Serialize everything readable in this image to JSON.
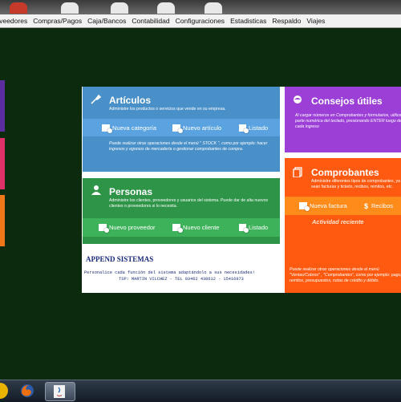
{
  "menu": {
    "items": [
      "Proveedores",
      "Compras/Pagos",
      "Caja/Bancos",
      "Contabilidad",
      "Configuraciones",
      "Estadisticas",
      "Respaldo",
      "Viajes"
    ]
  },
  "articulos": {
    "title": "Artículos",
    "description": "Administre los productos o servicios que vende en su empresa.",
    "actions": [
      "Nueva categoría",
      "Nuevo artículo",
      "Listado"
    ],
    "note": "Puede realizar otras operaciones desde el menú \" STOCK \", como por ejemplo: hacer ingresos y egresos de mercadería o gestionar comprobantes de compra.",
    "color": "#4a90c8",
    "bar_color": "#5ba3e0"
  },
  "personas": {
    "title": "Personas",
    "description": "Administre los clientes, proveedores y usuarios del sistema. Puede dar de alta nuevos clientes o proveedores si lo necesita.",
    "actions": [
      "Nuevo proveedor",
      "Nuevo cliente",
      "Listado"
    ],
    "color": "#2e9448",
    "bar_color": "#3db25a"
  },
  "append": {
    "title": "APPEND SISTEMAS",
    "line1": "Personalice cada función del sistema adaptándolo a sus necesidades!",
    "line2": "TSP: MARTIN VILCHEZ - TEL 03462 438612 - 15416973"
  },
  "consejos": {
    "title": "Consejos útiles",
    "description": "Al cargar números en Comprobantes y formularios, utilice la parte numérica del teclado, presionando ENTER luego de cada ingreso",
    "color": "#9b3fd6"
  },
  "comprobantes": {
    "title": "Comprobantes",
    "description": "Administre diferentes tipos de comprobantes, ya sean facturas y tickets, recibos, remitos, etc.",
    "actions": [
      "Nueva factura",
      "Recibos"
    ],
    "activity_label": "Actividad reciente",
    "note": "Puede realizar otras operaciones desde el menú \"Ventas/Cobros\" , \"Comprobantes\", como por ejemplo: pago, remitos, presupuestos, notas de crédito y débito.",
    "color": "#ff5a10",
    "bar_color": "#ff8c1a"
  },
  "side_tiles": [
    "#5b2d9e",
    "#e0306a",
    "#f07818"
  ]
}
